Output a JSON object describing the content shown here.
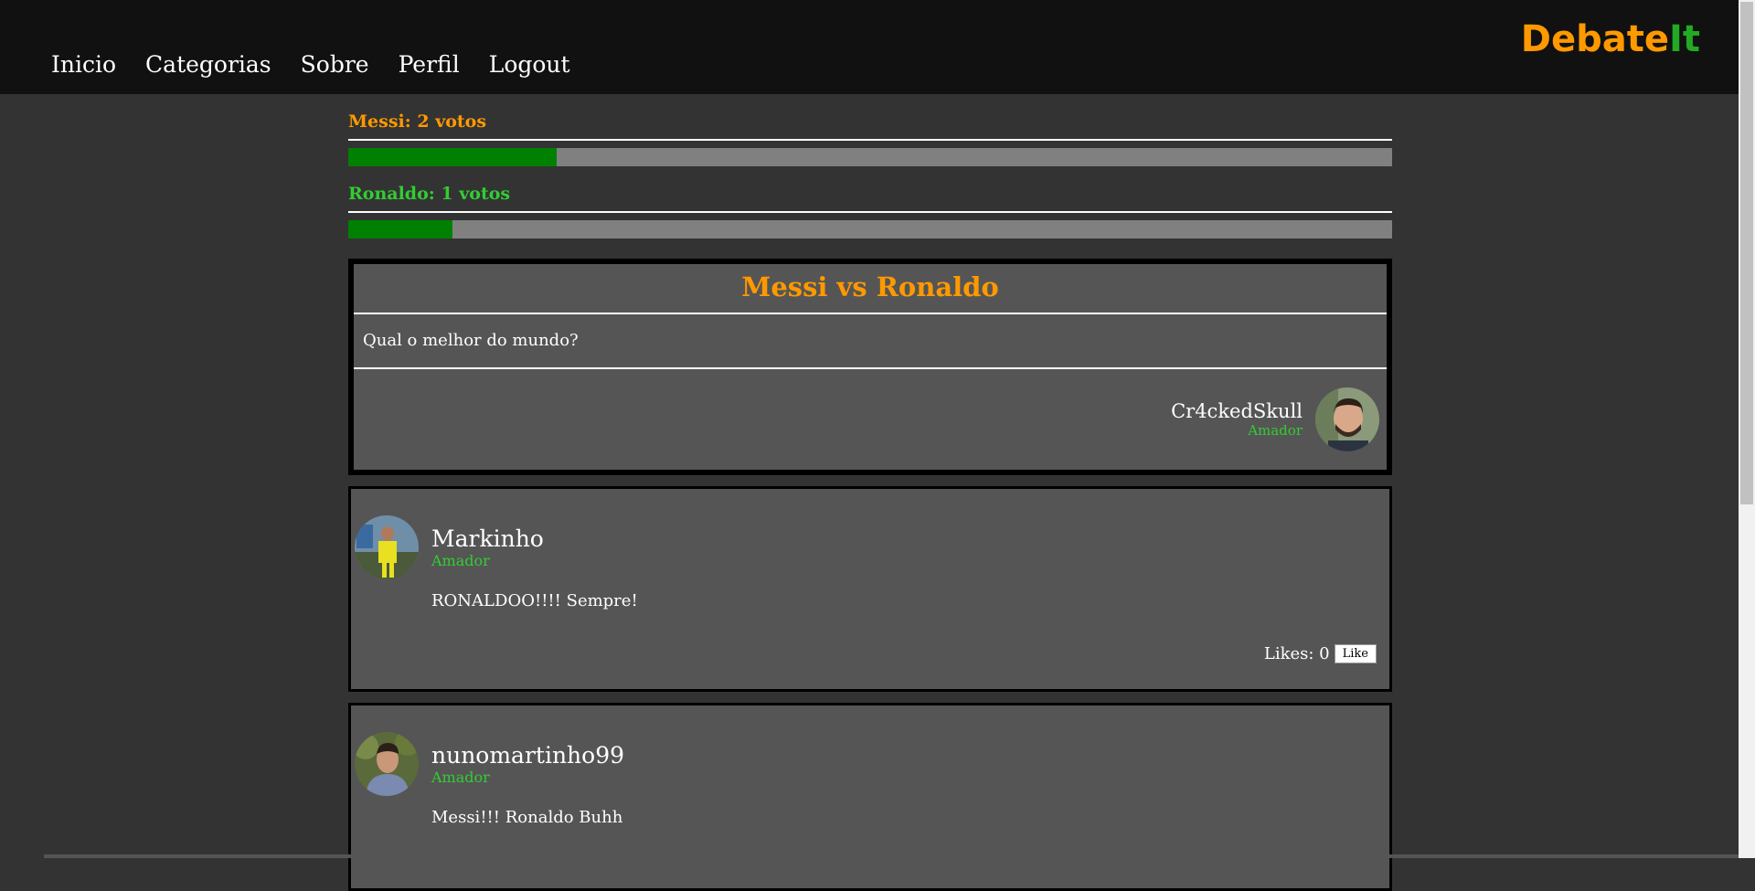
{
  "nav": {
    "links": [
      "Inicio",
      "Categorias",
      "Sobre",
      "Perfil",
      "Logout"
    ],
    "brand_part1": "Debate",
    "brand_part2": "It"
  },
  "votes": [
    {
      "label": "Messi: 2 votos",
      "share": 0.2
    },
    {
      "label": "Ronaldo: 1 votos",
      "share": 0.1
    }
  ],
  "debate": {
    "title": "Messi vs Ronaldo",
    "question": "Qual o melhor do mundo?",
    "author": "Cr4ckedSkull",
    "author_rank": "Amador"
  },
  "comments": [
    {
      "user": "Markinho",
      "rank": "Amador",
      "text": "RONALDOO!!!! Sempre!",
      "likes_label": "Likes: 0",
      "like_button": "Like"
    },
    {
      "user": "nunomartinho99",
      "rank": "Amador",
      "text": "Messi!!! Ronaldo Buhh"
    }
  ],
  "colors": {
    "accent_orange": "#ff9900",
    "accent_green": "#33cc33",
    "bar_green": "#008000",
    "bar_gray": "#808080",
    "background": "#333333",
    "navbar": "#111111",
    "card": "#555555"
  }
}
